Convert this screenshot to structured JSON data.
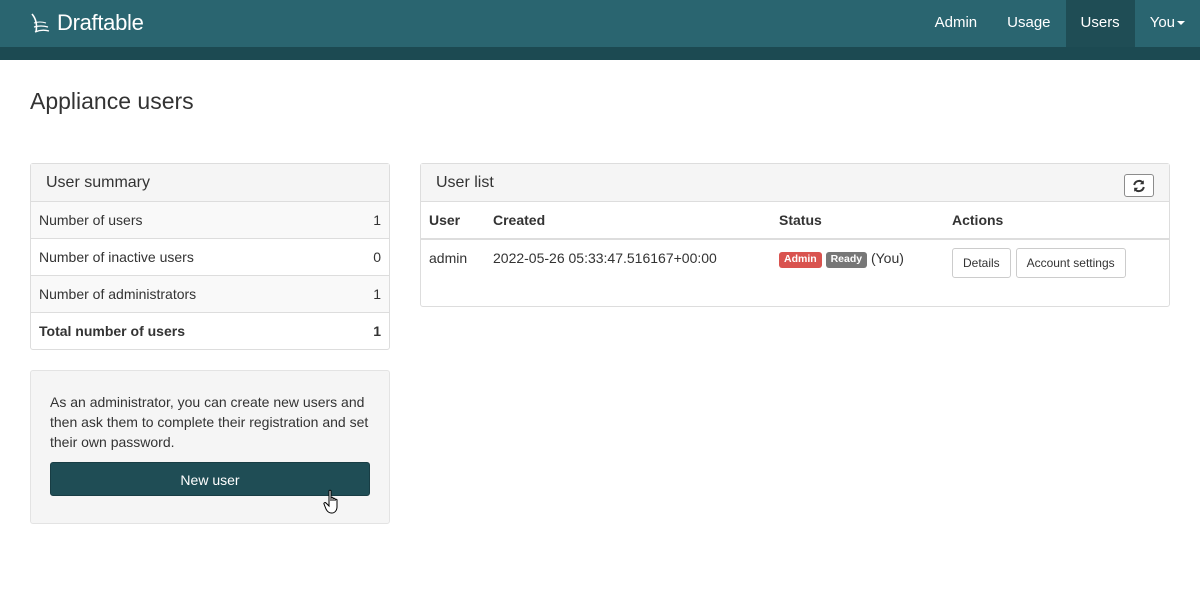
{
  "brand": {
    "name": "Draftable"
  },
  "nav": {
    "items": [
      {
        "label": "Admin",
        "active": false
      },
      {
        "label": "Usage",
        "active": false
      },
      {
        "label": "Users",
        "active": true
      },
      {
        "label": "You",
        "active": false,
        "dropdown": true
      }
    ]
  },
  "page": {
    "title": "Appliance users"
  },
  "summary": {
    "heading": "User summary",
    "rows": [
      {
        "label": "Number of users",
        "value": "1"
      },
      {
        "label": "Number of inactive users",
        "value": "0"
      },
      {
        "label": "Number of administrators",
        "value": "1"
      },
      {
        "label": "Total number of users",
        "value": "1"
      }
    ]
  },
  "info": {
    "text": "As an administrator, you can create new users and then ask them to complete their registration and set their own password.",
    "new_user_label": "New user"
  },
  "user_list": {
    "heading": "User list",
    "refresh_icon": "refresh-icon",
    "columns": [
      "User",
      "Created",
      "Status",
      "Actions"
    ],
    "rows": [
      {
        "user": "admin",
        "created": "2022-05-26 05:33:47.516167+00:00",
        "badges": [
          "Admin",
          "Ready"
        ],
        "status_note": "(You)",
        "actions": [
          "Details",
          "Account settings"
        ]
      }
    ]
  },
  "colors": {
    "navbar": "#2a6570",
    "navbar_strip": "#1c4a52",
    "primary_button": "#1f4d55",
    "badge_admin": "#d9534f",
    "badge_ready": "#777777"
  }
}
